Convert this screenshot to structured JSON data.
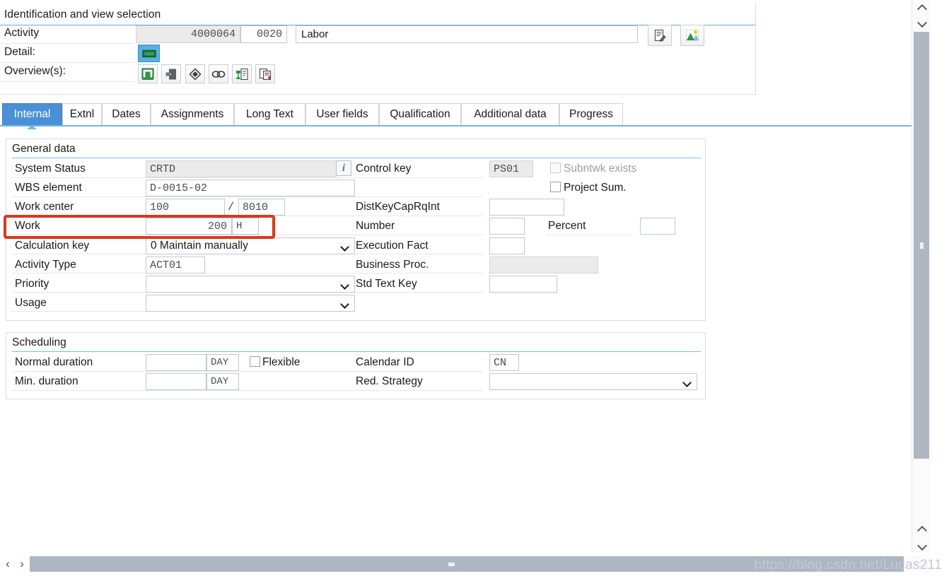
{
  "identification": {
    "title": "Identification and view selection",
    "rows": [
      {
        "label": "Activity"
      },
      {
        "label": "Detail:"
      },
      {
        "label": "Overview(s):"
      }
    ],
    "activity": {
      "number": "4000064",
      "counter": "0020",
      "description": "Labor",
      "buttons": [
        {
          "name": "long-text-edit-icon"
        },
        {
          "name": "graphic-view-icon"
        }
      ]
    },
    "detail_buttons": [
      {
        "name": "detail-screen-icon",
        "selected": true
      }
    ],
    "overview_buttons": [
      {
        "name": "component-overview-icon"
      },
      {
        "name": "relationship-overview-icon"
      },
      {
        "name": "milestone-overview-icon"
      },
      {
        "name": "link-overview-icon"
      },
      {
        "name": "prt-overview-icon"
      },
      {
        "name": "document-overview-icon"
      }
    ]
  },
  "tabs": [
    {
      "label": "Internal",
      "active": true
    },
    {
      "label": "Extnl",
      "active": false
    },
    {
      "label": "Dates",
      "active": false
    },
    {
      "label": "Assignments",
      "active": false
    },
    {
      "label": "Long Text",
      "active": false
    },
    {
      "label": "User fields",
      "active": false
    },
    {
      "label": "Qualification",
      "active": false
    },
    {
      "label": "Additional data",
      "active": false
    },
    {
      "label": "Progress",
      "active": false
    }
  ],
  "general_data": {
    "title": "General data",
    "left": {
      "system_status": {
        "label": "System Status",
        "value": "CRTD",
        "readonly": true
      },
      "wbs_element": {
        "label": "WBS element",
        "value": "D-0015-02"
      },
      "work_center": {
        "label": "Work center",
        "value": "100",
        "separator": "/",
        "plant": "8010"
      },
      "work": {
        "label": "Work",
        "value": "200",
        "unit": "H",
        "highlighted": true
      },
      "calculation_key": {
        "label": "Calculation key",
        "value": "0 Maintain manually"
      },
      "activity_type": {
        "label": "Activity Type",
        "value": "ACT01"
      },
      "priority": {
        "label": "Priority",
        "value": ""
      },
      "usage": {
        "label": "Usage",
        "value": ""
      }
    },
    "right": {
      "control_key": {
        "label": "Control key",
        "value": "PS01",
        "readonly": true
      },
      "subntwk_exists": {
        "label": "Subntwk exists",
        "checked": false,
        "disabled": true
      },
      "project_sum": {
        "label": "Project Sum.",
        "checked": false,
        "disabled": false
      },
      "dist_key_cap": {
        "label": "DistKeyCapRqInt",
        "value": ""
      },
      "number": {
        "label": "Number",
        "value": ""
      },
      "percent": {
        "label": "Percent",
        "value": ""
      },
      "execution_fact": {
        "label": "Execution Fact",
        "value": ""
      },
      "business_proc": {
        "label": "Business Proc.",
        "value": "",
        "readonly": true
      },
      "std_text_key": {
        "label": "Std Text Key",
        "value": ""
      }
    }
  },
  "scheduling": {
    "title": "Scheduling",
    "normal_duration": {
      "label": "Normal duration",
      "value": "",
      "unit": "DAY"
    },
    "min_duration": {
      "label": "Min. duration",
      "value": "",
      "unit": "DAY"
    },
    "flexible": {
      "label": "Flexible",
      "checked": false
    },
    "calendar_id": {
      "label": "Calendar ID",
      "value": "CN"
    },
    "red_strategy": {
      "label": "Red. Strategy",
      "value": ""
    }
  },
  "annotation": {
    "target": "work-field-row",
    "color": "#d9381e"
  },
  "scrollbars": {
    "vertical": {
      "up": "scroll-up",
      "down": "scroll-down"
    },
    "horizontal": {
      "left": "‹",
      "right": "›"
    }
  },
  "watermark": "https://blog.csdn.net/Lucas211",
  "colors": {
    "accent_blue": "#4b90d6",
    "rule_blue": "#74b4e3",
    "highlight_red": "#d9381e",
    "readonly_grey": "#ebebeb",
    "scroll_thumb": "#aeb6c2"
  }
}
